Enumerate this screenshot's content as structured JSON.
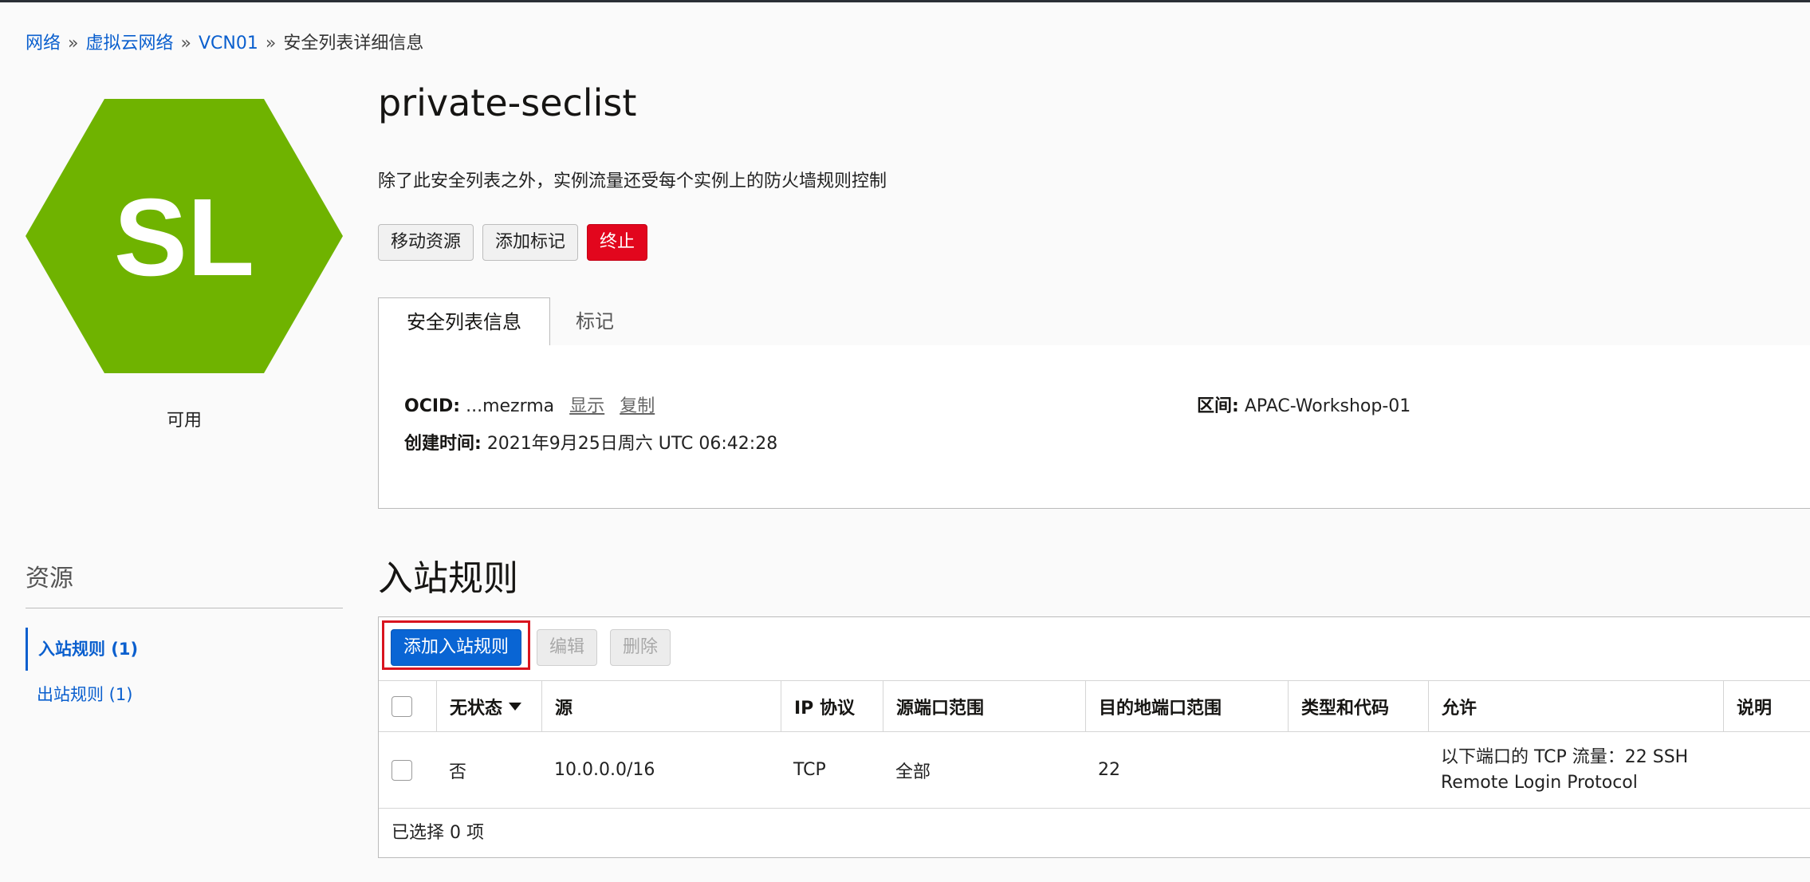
{
  "breadcrumb": {
    "items": [
      {
        "label": "网络"
      },
      {
        "label": "虚拟云网络"
      },
      {
        "label": "VCN01"
      }
    ],
    "separator": "»",
    "current": "安全列表详细信息"
  },
  "resource_badge": {
    "initials": "SL",
    "color": "#6fb300",
    "status": "可用"
  },
  "header": {
    "title": "private-seclist",
    "subtitle": "除了此安全列表之外，实例流量还受每个实例上的防火墙规则控制"
  },
  "actions": {
    "move": "移动资源",
    "tag": "添加标记",
    "terminate": "终止"
  },
  "tabs": [
    {
      "label": "安全列表信息",
      "active": true
    },
    {
      "label": "标记",
      "active": false
    }
  ],
  "info": {
    "ocid_label": "OCID:",
    "ocid_value": "...mezrma",
    "show_link": "显示",
    "copy_link": "复制",
    "created_label": "创建时间:",
    "created_value": "2021年9月25日周六 UTC 06:42:28",
    "compartment_label": "区间:",
    "compartment_value": "APAC-Workshop-01"
  },
  "resources": {
    "title": "资源",
    "items": [
      {
        "label": "入站规则 (1)",
        "active": true
      },
      {
        "label": "出站规则 (1)",
        "active": false
      }
    ]
  },
  "ingress": {
    "title": "入站规则",
    "toolbar": {
      "add": "添加入站规则",
      "edit": "编辑",
      "delete": "删除"
    },
    "columns": {
      "stateless": "无状态",
      "source": "源",
      "ip_protocol": "IP 协议",
      "source_port": "源端口范围",
      "dest_port": "目的地端口范围",
      "type_code": "类型和代码",
      "allows": "允许",
      "description": "说明"
    },
    "rows": [
      {
        "stateless": "否",
        "source": "10.0.0.0/16",
        "ip_protocol": "TCP",
        "source_port": "全部",
        "dest_port": "22",
        "type_code": "",
        "allows": "以下端口的 TCP 流量：22 SSH Remote Login Protocol",
        "description": ""
      }
    ],
    "selected_text": "已选择 0 项"
  },
  "colors": {
    "link": "#0a5fce",
    "primary": "#0965d4",
    "danger": "#e2061d",
    "highlight": "#d9141f"
  }
}
